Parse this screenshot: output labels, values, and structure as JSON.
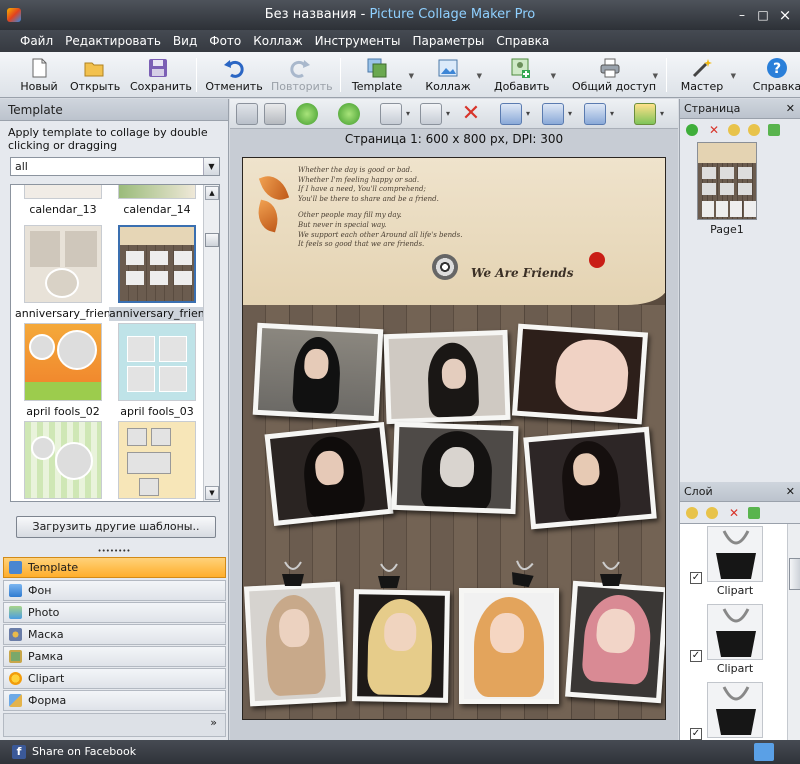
{
  "window": {
    "title_doc": "Без названия",
    "title_sep": " - ",
    "title_app": "Picture Collage Maker Pro",
    "min": "–",
    "max": "□",
    "close": "×"
  },
  "menu": [
    "Файл",
    "Редактировать",
    "Вид",
    "Фото",
    "Коллаж",
    "Инструменты",
    "Параметры",
    "Справка"
  ],
  "toolbar": {
    "new": "Новый",
    "open": "Открыть",
    "save": "Сохранить",
    "undo": "Отменить",
    "redo": "Повторить",
    "template": "Template",
    "collage": "Коллаж",
    "add": "Добавить",
    "share": "Общий доступ",
    "wizard": "Мастер",
    "help": "Справка"
  },
  "left_panel": {
    "header": "Template",
    "hint": "Apply template to collage by double clicking or dragging",
    "filter_value": "all",
    "templates": [
      "calendar_13",
      "calendar_14",
      "anniversary_frien...",
      "anniversary_frien...",
      "april fools_02",
      "april fools_03"
    ],
    "load_more": "Загрузить другие шаблоны..",
    "categories": [
      "Template",
      "Фон",
      "Photo",
      "Маска",
      "Рамка",
      "Clipart",
      "Форма"
    ],
    "more": "»"
  },
  "editor": {
    "page_info": "Страница 1: 600 x 800 px, DPI: 300"
  },
  "collage": {
    "poem": [
      "Whether the day is good or bad.",
      "Whether I'm feeling happy or sad.",
      "If I have a need, You'll comprehend;",
      "You'll be there to share and be a friend.",
      "",
      "Other people may fill my day.",
      "But never in special way.",
      "We support each other Around all life's bends.",
      "It feels so good that we are friends."
    ],
    "slogan": "We Are Friends"
  },
  "right_panel": {
    "page_header": "Страница",
    "page_label": "Page1",
    "layer_header": "Слой",
    "layers": [
      "Clipart",
      "Clipart",
      ""
    ]
  },
  "status": {
    "facebook": "Share on Facebook"
  },
  "colors": {
    "active_tab": "#ffae2b",
    "title_accent": "#8fd0ff"
  }
}
